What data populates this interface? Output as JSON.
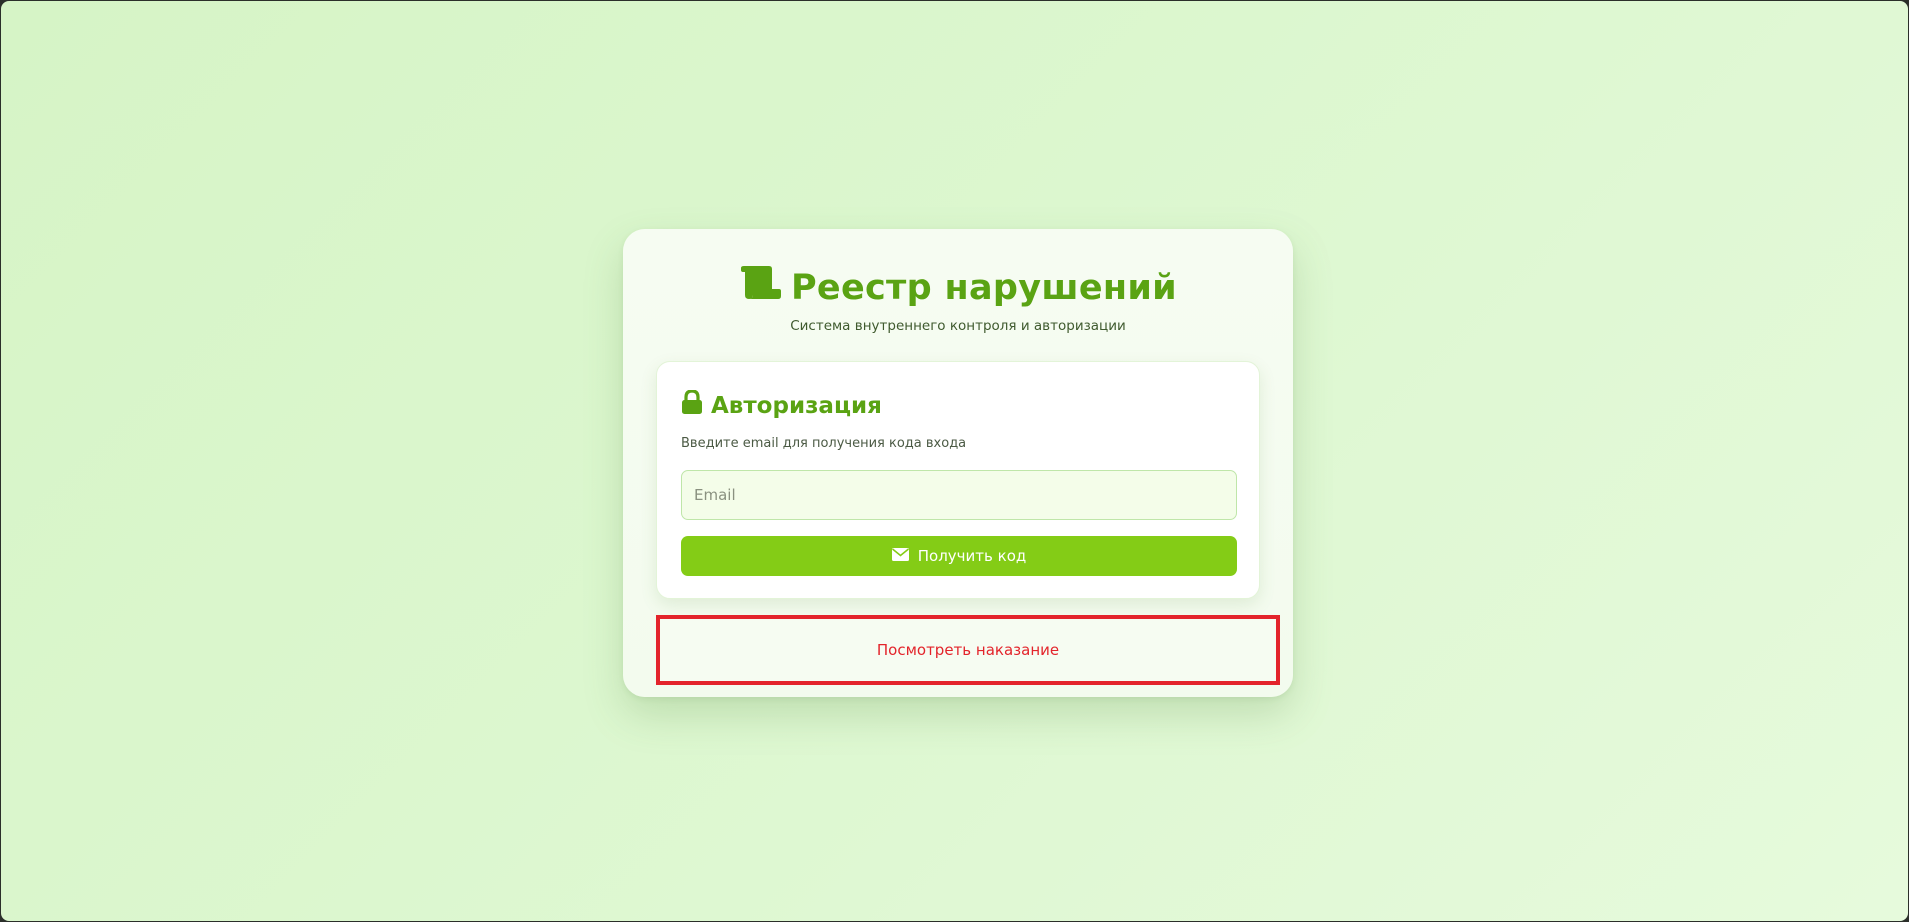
{
  "header": {
    "logo_icon": "scroll-icon",
    "title": "Реестр нарушений",
    "subtitle": "Система внутреннего контроля и авторизации"
  },
  "login": {
    "icon": "lock-icon",
    "title": "Авторизация",
    "hint": "Введите email для получения кода входа",
    "email_placeholder": "Email",
    "email_value": "",
    "submit_icon": "envelope-icon",
    "submit_label": "Получить код"
  },
  "punishment": {
    "link_label": "Посмотреть наказание"
  },
  "colors": {
    "accent": "#5aa313",
    "button": "#84cc16",
    "highlight": "#e3242b",
    "background": "#dcf7cf"
  }
}
